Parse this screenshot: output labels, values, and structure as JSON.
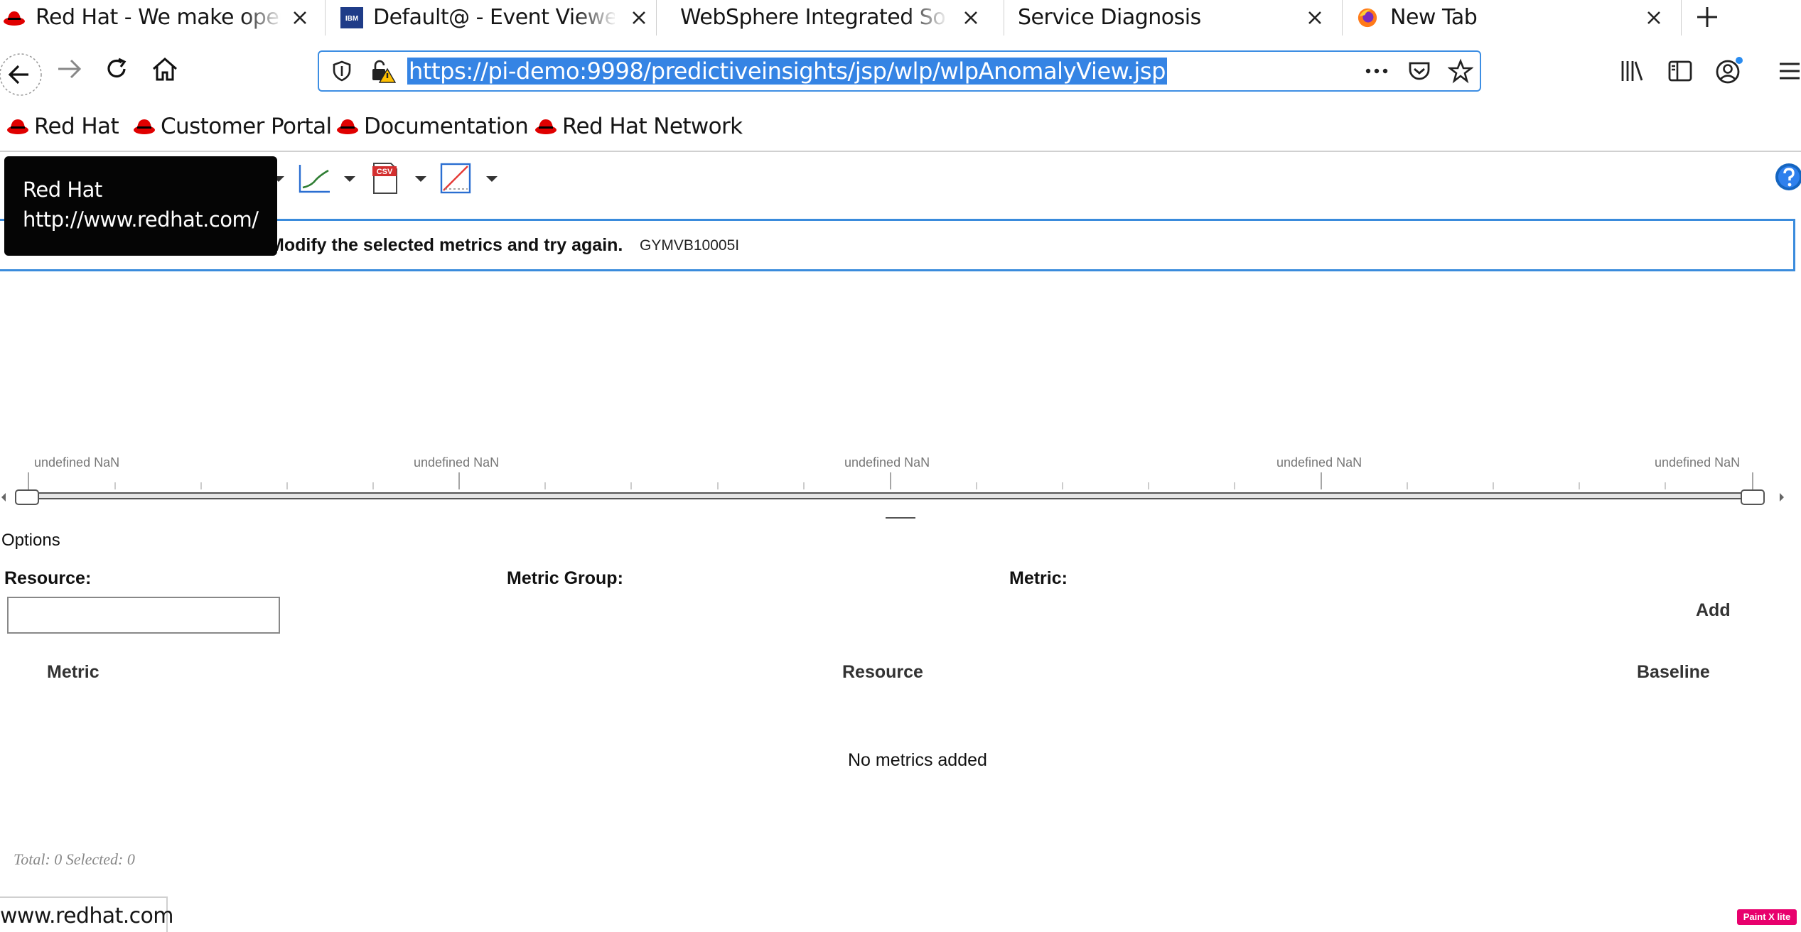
{
  "tabs": [
    {
      "title": "Red Hat - We make open source technologies",
      "icon": "redhat-fedora-icon"
    },
    {
      "title": "Default@ - Event Viewer",
      "icon": "ibm-icon"
    },
    {
      "title": "WebSphere Integrated Solutions Console",
      "icon": "none"
    },
    {
      "title": "Service Diagnosis",
      "icon": "none",
      "active": true
    },
    {
      "title": "New Tab",
      "icon": "firefox-icon"
    }
  ],
  "ibm_favicon_text": "IBM",
  "urlbar": {
    "url": "https://pi-demo:9998/predictiveinsights/jsp/wlp/wlpAnomalyView.jsp"
  },
  "bookmarks": [
    {
      "label": "Red Hat"
    },
    {
      "label": "Customer Portal"
    },
    {
      "label": "Documentation"
    },
    {
      "label": "Red Hat Network"
    }
  ],
  "tooltip": {
    "title": "Red Hat",
    "url": "http://www.redhat.com/"
  },
  "toolbar": {
    "csv_label": "CSV"
  },
  "message": {
    "text": "Modify the selected metrics and try again.",
    "code": "GYMVB10005I"
  },
  "timeline": {
    "labels": [
      "undefined NaN",
      "undefined NaN",
      "undefined NaN",
      "undefined NaN",
      "undefined NaN"
    ]
  },
  "options": {
    "title": "Options",
    "resource_label": "Resource:",
    "metric_group_label": "Metric Group:",
    "metric_label": "Metric:",
    "resource_value": "",
    "add_label": "Add"
  },
  "table": {
    "columns": [
      "Metric",
      "Resource",
      "Baseline"
    ],
    "empty_message": "No metrics added",
    "totals": "Total: 0 Selected: 0"
  },
  "status": {
    "link": "www.redhat.com"
  },
  "badge": "Paint X lite",
  "colors": {
    "accent": "#3584e4",
    "redhat": "#e00000",
    "focus_border": "#3a8bdc"
  }
}
